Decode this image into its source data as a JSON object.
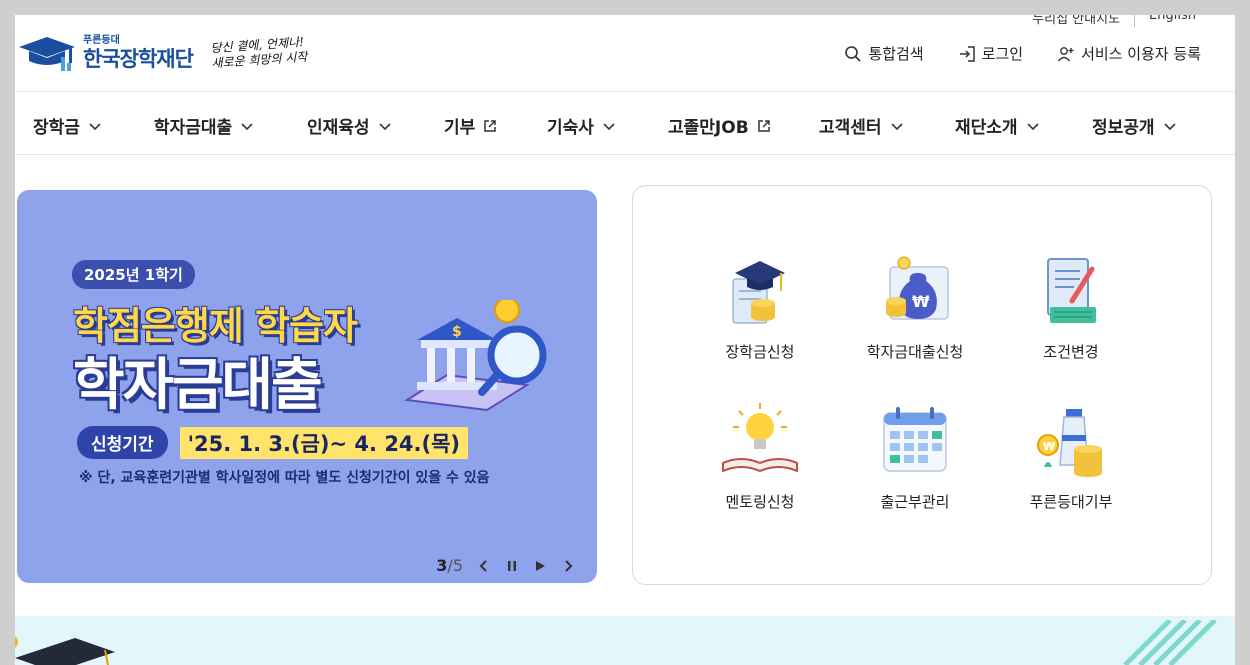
{
  "util": {
    "items": [
      "누리집 안내지도",
      "English"
    ]
  },
  "logo": {
    "small": "푸른등대",
    "main": "한국장학재단",
    "slogan_line1": "당신 곁에, 언제나!",
    "slogan_line2": "새로운 희망의 시작"
  },
  "top_links": [
    {
      "label": "통합검색",
      "icon": "search-icon"
    },
    {
      "label": "로그인",
      "icon": "login-icon"
    },
    {
      "label": "서비스 이용자 등록",
      "icon": "user-add-icon"
    }
  ],
  "nav": [
    {
      "label": "장학금",
      "icon": "chevron-down-icon"
    },
    {
      "label": "학자금대출",
      "icon": "chevron-down-icon"
    },
    {
      "label": "인재육성",
      "icon": "chevron-down-icon"
    },
    {
      "label": "기부",
      "icon": "external-link-icon"
    },
    {
      "label": "기숙사",
      "icon": "chevron-down-icon"
    },
    {
      "label": "고졸만JOB",
      "icon": "external-link-icon"
    },
    {
      "label": "고객센터",
      "icon": "chevron-down-icon"
    },
    {
      "label": "재단소개",
      "icon": "chevron-down-icon"
    },
    {
      "label": "정보공개",
      "icon": "chevron-down-icon"
    }
  ],
  "banner": {
    "badge": "2025년 1학기",
    "title1": "학점은행제 학습자",
    "title2": "학자금대출",
    "period_label": "신청기간",
    "period_dates": "'25. 1. 3.(금)~ 4. 24.(목)",
    "note": "※ 단, 교육훈련기관별 학사일정에 따라 별도 신청기간이 있을 수 있음",
    "bg_color": "#8fa2ec"
  },
  "slider": {
    "current": "3",
    "total": "/5"
  },
  "quick_menu": [
    {
      "label": "장학금신청",
      "icon": "graduation-cap-icon"
    },
    {
      "label": "학자금대출신청",
      "icon": "money-bag-icon"
    },
    {
      "label": "조건변경",
      "icon": "document-edit-icon"
    },
    {
      "label": "멘토링신청",
      "icon": "lightbulb-icon"
    },
    {
      "label": "출근부관리",
      "icon": "calendar-icon"
    },
    {
      "label": "푸른등대기부",
      "icon": "lighthouse-icon"
    }
  ]
}
